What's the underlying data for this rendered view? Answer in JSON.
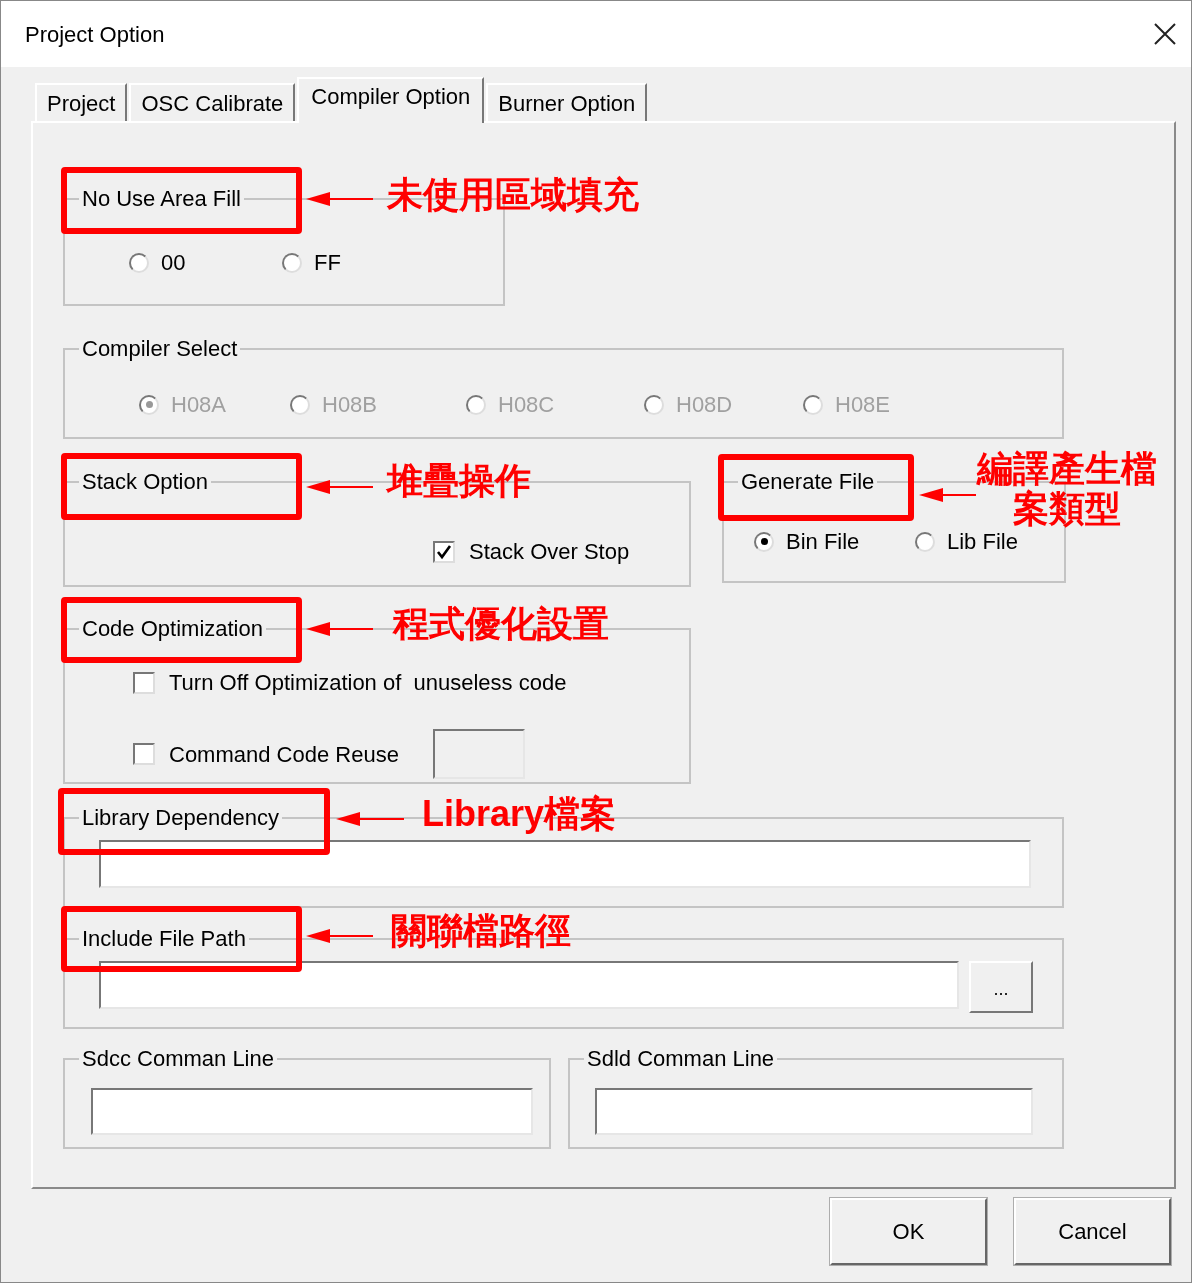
{
  "window": {
    "title": "Project Option"
  },
  "tabs": [
    {
      "label": "Project",
      "selected": false
    },
    {
      "label": "OSC Calibrate",
      "selected": false
    },
    {
      "label": "Compiler Option",
      "selected": true
    },
    {
      "label": "Burner Option",
      "selected": false
    }
  ],
  "no_use_area_fill": {
    "title": "No Use Area Fill",
    "options": [
      {
        "label": "00",
        "selected": false
      },
      {
        "label": "FF",
        "selected": false
      }
    ]
  },
  "compiler_select": {
    "title": "Compiler Select",
    "disabled": true,
    "options": [
      {
        "label": "H08A",
        "selected": true
      },
      {
        "label": "H08B",
        "selected": false
      },
      {
        "label": "H08C",
        "selected": false
      },
      {
        "label": "H08D",
        "selected": false
      },
      {
        "label": "H08E",
        "selected": false
      }
    ]
  },
  "stack_option": {
    "title": "Stack Option",
    "checkboxes": [
      {
        "label": "Stack Over Stop",
        "checked": true
      }
    ]
  },
  "generate_file": {
    "title": "Generate File",
    "options": [
      {
        "label": "Bin File",
        "selected": true
      },
      {
        "label": "Lib File",
        "selected": false
      }
    ]
  },
  "code_optimization": {
    "title": "Code Optimization",
    "checkboxes": [
      {
        "label": "Turn Off Optimization of  unuseless code",
        "checked": false
      },
      {
        "label": "Command Code Reuse",
        "checked": false
      }
    ]
  },
  "library_dependency": {
    "title": "Library Dependency"
  },
  "include_file_path": {
    "title": "Include File Path",
    "browse_button": "..."
  },
  "sdcc_command_line": {
    "title": "Sdcc Comman Line"
  },
  "sdld_command_line": {
    "title": "Sdld Comman Line"
  },
  "buttons": [
    "OK",
    "Cancel"
  ],
  "annotations": [
    {
      "label": "未使用區域填充"
    },
    {
      "label": "堆疊操作"
    },
    {
      "label": "編譯產生檔案類型"
    },
    {
      "label": "程式優化設置"
    },
    {
      "label": "Library檔案"
    },
    {
      "label": "關聯檔路徑"
    }
  ]
}
